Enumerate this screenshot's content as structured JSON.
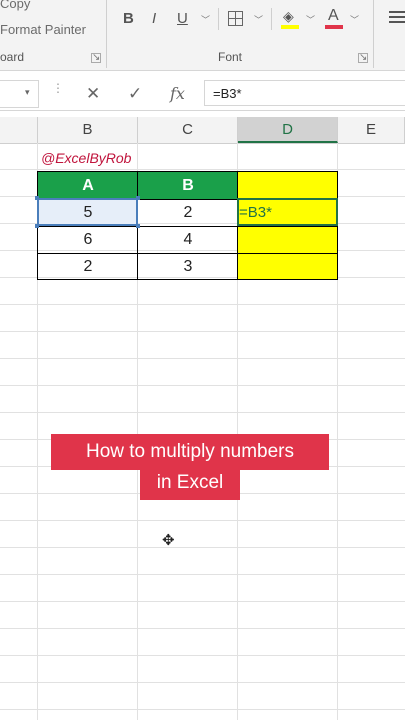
{
  "ribbon": {
    "clipboard": {
      "copy_label": "Copy",
      "format_painter_label": "Format Painter",
      "group_label": "oard"
    },
    "font": {
      "group_label": "Font",
      "bold_label": "B",
      "italic_label": "I",
      "underline_label": "U",
      "font_color_letter": "A"
    }
  },
  "formula_bar": {
    "name_box_value": "",
    "cancel_icon": "✕",
    "enter_icon": "✓",
    "fx_label": "fx",
    "formula": "=B3*"
  },
  "columns": [
    "B",
    "C",
    "D",
    "E"
  ],
  "sheet": {
    "watermark": "@ExcelByRob",
    "header_row": [
      "A",
      "B",
      ""
    ],
    "rows": [
      [
        "5",
        "2",
        "=B3*"
      ],
      [
        "6",
        "4",
        ""
      ],
      [
        "2",
        "3",
        ""
      ]
    ]
  },
  "overlay": {
    "title_line1": "How to multiply numbers",
    "title_line2": "in Excel"
  },
  "colors": {
    "header_green": "#1aa04a",
    "highlight_yellow": "#ffff00",
    "title_red": "#e0344a",
    "selected_cell": "#e6eef9"
  }
}
